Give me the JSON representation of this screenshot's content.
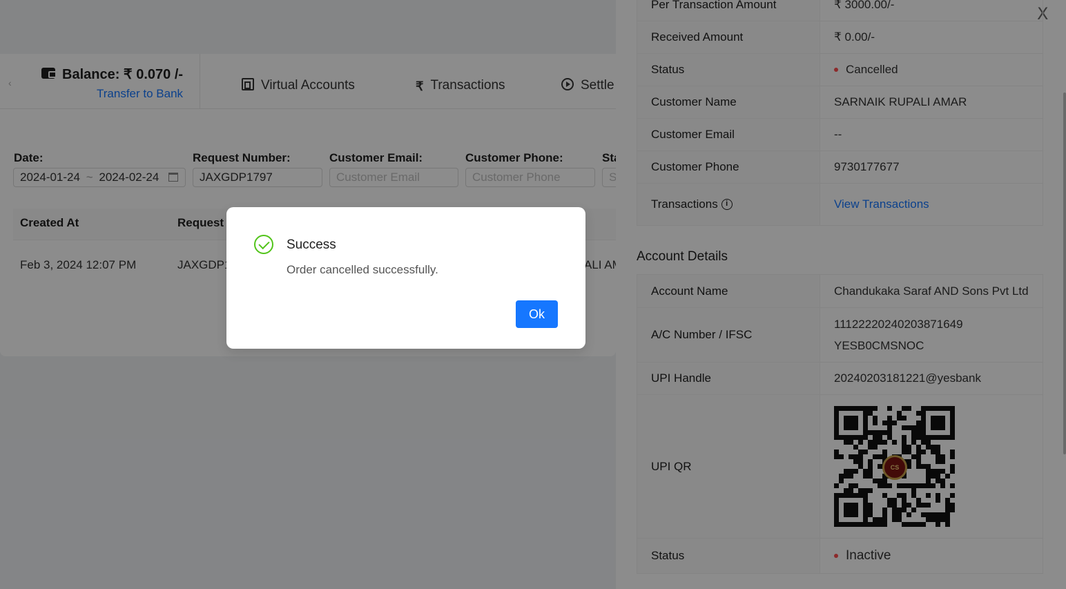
{
  "header": {
    "balance_label": "Balance:  ₹ 0.070 /-",
    "transfer_link": "Transfer to Bank",
    "tabs": [
      "Virtual Accounts",
      "Transactions",
      "Settle"
    ]
  },
  "filters": {
    "date_label": "Date:",
    "date_start": "2024-01-24",
    "date_separator": "~",
    "date_end": "2024-02-24",
    "request_label": "Request Number:",
    "request_value": "JAXGDP1797",
    "email_label": "Customer Email:",
    "email_placeholder": "Customer Email",
    "phone_label": "Customer Phone:",
    "phone_placeholder": "Customer Phone",
    "status_label": "Sta",
    "status_placeholder": "S"
  },
  "table": {
    "headers": [
      "Created At",
      "Request"
    ],
    "row": {
      "created_at": "Feb 3, 2024 12:07 PM",
      "request": "JAXGDP1",
      "customer_partial": "ALI AM"
    }
  },
  "drawer": {
    "close": "X",
    "order_rows": [
      {
        "label": "Per Transaction Amount",
        "value": "₹ 3000.00/-"
      },
      {
        "label": "Received Amount",
        "value": "₹ 0.00/-"
      },
      {
        "label": "Status",
        "value": "Cancelled"
      },
      {
        "label": "Customer Name",
        "value": "SARNAIK RUPALI AMAR"
      },
      {
        "label": "Customer Email",
        "value": "--"
      },
      {
        "label": "Customer Phone",
        "value": "9730177677"
      },
      {
        "label": "Transactions",
        "value": "View Transactions"
      }
    ],
    "account_title": "Account Details",
    "account_rows": [
      {
        "label": "Account Name",
        "value": "Chandukaka Saraf AND Sons Pvt Ltd"
      },
      {
        "label": "A/C Number / IFSC",
        "value": "11122220240203871649",
        "value2": "YESB0CMSNOC"
      },
      {
        "label": "UPI Handle",
        "value": "20240203181221@yesbank"
      },
      {
        "label": "UPI QR",
        "logo_text": "CS"
      },
      {
        "label": "Status",
        "value": "Inactive"
      }
    ]
  },
  "modal": {
    "title": "Success",
    "message": "Order cancelled successfully.",
    "ok_label": "Ok"
  },
  "colors": {
    "primary": "#1677ff",
    "success": "#52c41a",
    "error_dot": "#ff4d4f"
  }
}
